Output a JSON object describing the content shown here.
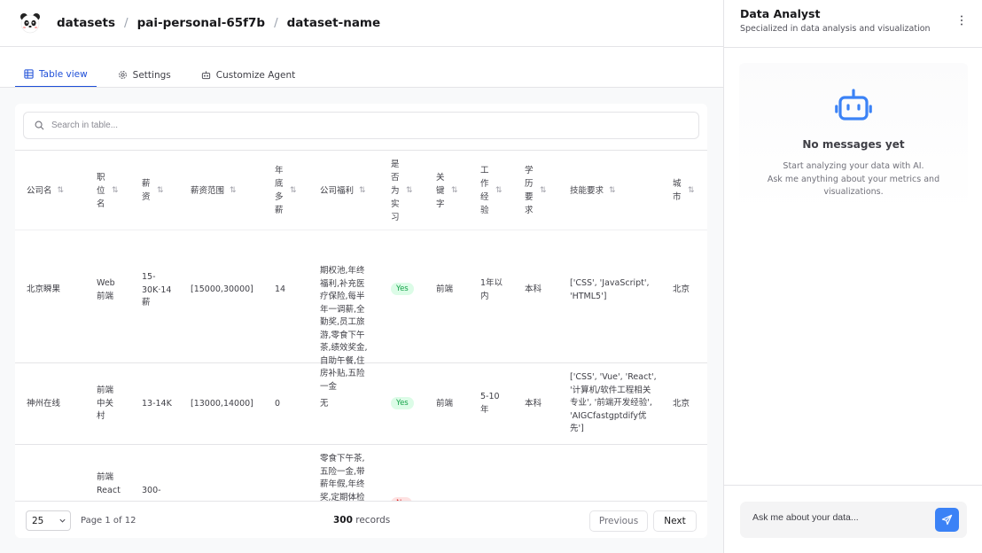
{
  "breadcrumb": {
    "root": "datasets",
    "workspace": "pai-personal-65f7b",
    "dataset": "dataset-name",
    "separator": "/"
  },
  "tabs": [
    {
      "label": "Table view",
      "icon": "table-icon",
      "active": true
    },
    {
      "label": "Settings",
      "icon": "gear-icon",
      "active": false
    },
    {
      "label": "Customize Agent",
      "icon": "bot-icon",
      "active": false
    }
  ],
  "search": {
    "placeholder": "Search in table..."
  },
  "table": {
    "columns": [
      "公司名",
      "职位名",
      "薪资",
      "薪资范围",
      "年底多薪",
      "公司福利",
      "是否为实习",
      "关键字",
      "工作经验",
      "学历要求",
      "技能要求",
      "城市"
    ],
    "rows": [
      {
        "company": "北京瞬果",
        "position": "Web前端",
        "salary": "15-30K·14薪",
        "range": "[15000,30000]",
        "bonus": "14",
        "welfare": "期权池,年终福利,补充医疗保险,每半年一调薪,全勤奖,员工旅游,零食下午茶,绩效奖金,自助午餐,住房补贴,五险一金",
        "intern": "Yes",
        "keyword": "前端",
        "experience": "1年以内",
        "education": "本科",
        "skills": "['CSS', 'JavaScript', 'HTML5']",
        "city": "北京"
      },
      {
        "company": "神州在线",
        "position": "前端中关村",
        "salary": "13-14K",
        "range": "[13000,14000]",
        "bonus": "0",
        "welfare": "无",
        "intern": "Yes",
        "keyword": "前端",
        "experience": "5-10年",
        "education": "本科",
        "skills": "['CSS', 'Vue', 'React', '计算机/软件工程相关专业', '前端开发经验', 'AIGCfastgptdify优先']",
        "city": "北京"
      },
      {
        "company": "",
        "position": "前端React",
        "salary": "300-",
        "range": "",
        "bonus": "",
        "welfare": "零食下午茶,五险一金,带薪年假,年终奖,定期体检",
        "intern": "No",
        "keyword": "",
        "experience": "",
        "education": "",
        "skills": "",
        "city": ""
      }
    ]
  },
  "pagination": {
    "page_size": "25",
    "page_info": "Page 1 of 12",
    "record_count": "300",
    "record_label": "records",
    "prev": "Previous",
    "next": "Next"
  },
  "agent": {
    "title": "Data Analyst",
    "subtitle": "Specialized in data analysis and visualization",
    "empty_title": "No messages yet",
    "empty_line1": "Start analyzing your data with AI.",
    "empty_line2": "Ask me anything about your metrics and visualizations.",
    "input_placeholder": "Ask me about your data..."
  },
  "colors": {
    "accent": "#1d4ed8",
    "send_button": "#3b82f6",
    "badge_yes_bg": "#dcfce7",
    "badge_yes_text": "#16a34a"
  }
}
